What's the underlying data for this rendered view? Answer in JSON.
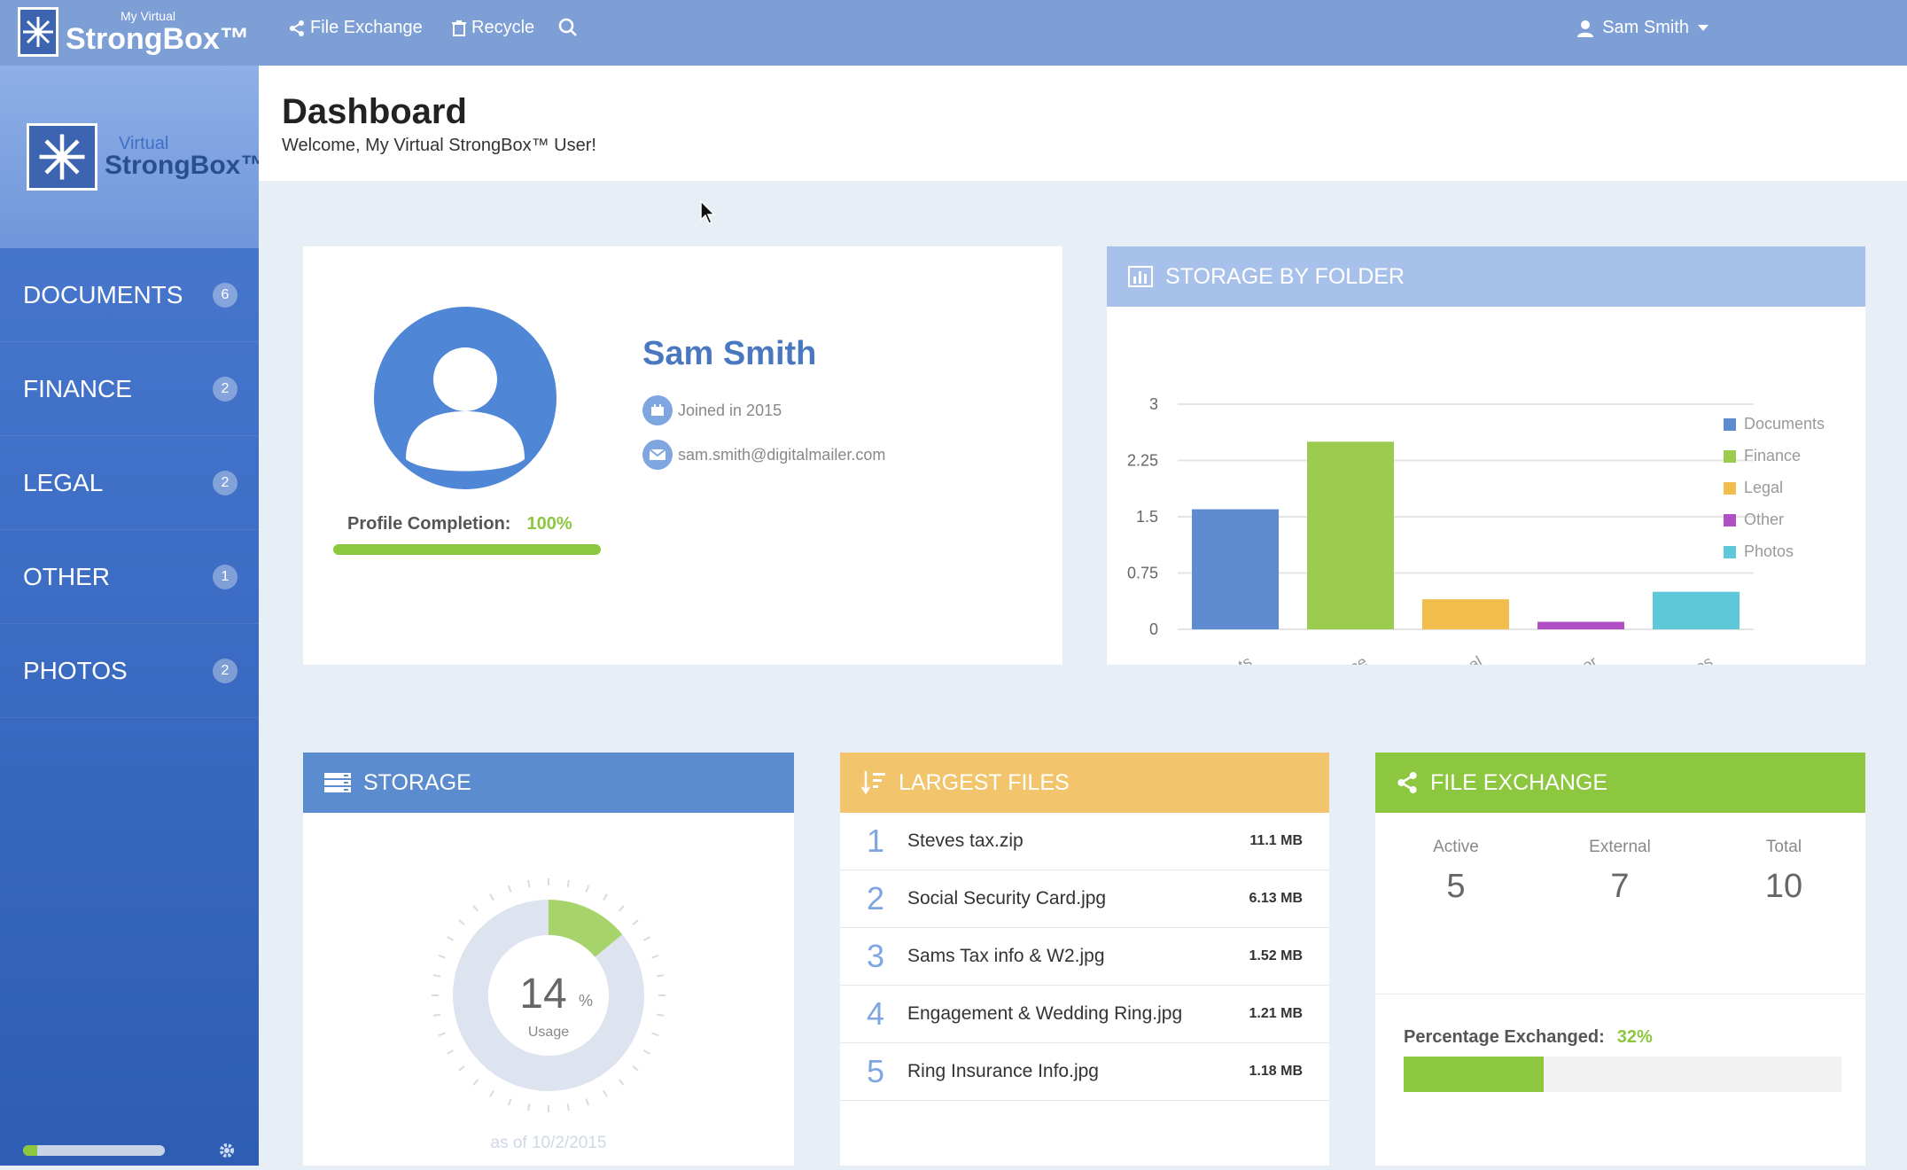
{
  "topbar": {
    "brand_small": "My Virtual",
    "brand_big": "StrongBox™",
    "links": [
      {
        "label": "File Exchange",
        "icon": "share-icon"
      },
      {
        "label": "Recycle",
        "icon": "trash-icon"
      }
    ],
    "search_icon": "search-icon",
    "user": "Sam Smith"
  },
  "sidebar": {
    "logo_small": "Virtual",
    "logo_big": "StrongBox™",
    "items": [
      {
        "label": "DOCUMENTS",
        "count": "6"
      },
      {
        "label": "FINANCE",
        "count": "2"
      },
      {
        "label": "LEGAL",
        "count": "2"
      },
      {
        "label": "OTHER",
        "count": "1"
      },
      {
        "label": "PHOTOS",
        "count": "2"
      }
    ],
    "footer_progress": 0.1
  },
  "header": {
    "title": "Dashboard",
    "subtitle": "Welcome, My Virtual StrongBox™ User!"
  },
  "profile": {
    "name": "Sam Smith",
    "joined": "Joined in 2015",
    "email": "sam.smith@digitalmailer.com",
    "completion_label": "Profile Completion:",
    "completion_value": "100%",
    "completion_fraction": 1.0
  },
  "folder_chart": {
    "title": "STORAGE BY FOLDER",
    "chart_data": {
      "type": "bar",
      "categories": [
        "Documents",
        "Finance",
        "Legal",
        "Other",
        "Photos"
      ],
      "values": [
        1.6,
        2.5,
        0.4,
        0.1,
        0.5
      ],
      "colors": [
        "#5f8bd0",
        "#9ccc4f",
        "#f1bd4d",
        "#b04fc4",
        "#5ec8d8"
      ],
      "ylim": [
        0,
        3
      ],
      "yticks": [
        "0",
        "0.75",
        "1.5",
        "2.25",
        "3"
      ],
      "ytick_values": [
        0,
        0.75,
        1.5,
        2.25,
        3
      ],
      "legend_position": "right"
    }
  },
  "storage": {
    "title": "STORAGE",
    "usage_value": "14",
    "usage_unit": "%",
    "usage_label": "Usage",
    "usage_fraction": 0.14,
    "as_of": "as of 10/2/2015"
  },
  "largest_files": {
    "title": "LARGEST FILES",
    "files": [
      {
        "num": "1",
        "name": "Steves tax.zip",
        "size": "11.1 MB"
      },
      {
        "num": "2",
        "name": "Social Security Card.jpg",
        "size": "6.13 MB"
      },
      {
        "num": "3",
        "name": "Sams Tax info & W2.jpg",
        "size": "1.52 MB"
      },
      {
        "num": "4",
        "name": "Engagement & Wedding Ring.jpg",
        "size": "1.21 MB"
      },
      {
        "num": "5",
        "name": "Ring Insurance Info.jpg",
        "size": "1.18 MB"
      }
    ]
  },
  "exchange": {
    "title": "FILE EXCHANGE",
    "active_label": "Active",
    "active_value": "5",
    "external_label": "External",
    "external_value": "7",
    "total_label": "Total",
    "total_value": "10",
    "pct_label": "Percentage Exchanged:",
    "pct_value": "32%",
    "pct_fraction": 0.32
  }
}
